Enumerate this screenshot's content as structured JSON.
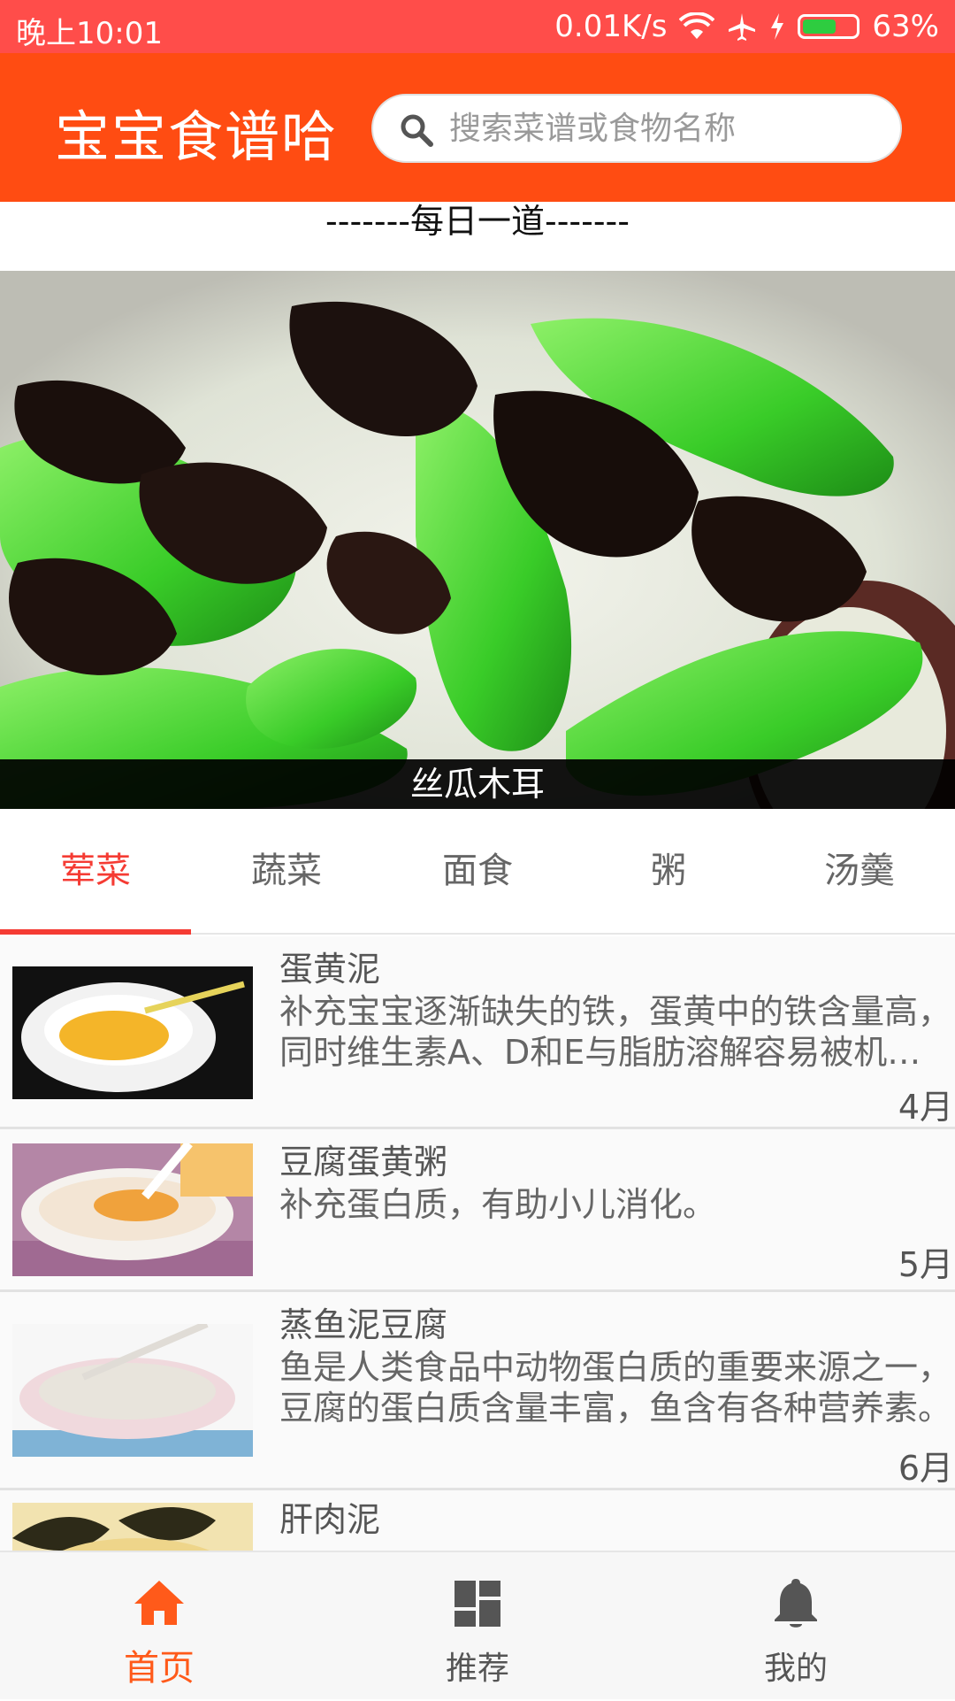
{
  "status_bar": {
    "time": "晚上10:01",
    "network_speed": "0.01K/s",
    "battery_percent": "63%",
    "battery_level": 0.63
  },
  "header": {
    "app_title": "宝宝食谱哈",
    "search_placeholder": "搜索菜谱或食物名称"
  },
  "daily": {
    "heading": "-------每日一道-------",
    "dish_name": "丝瓜木耳"
  },
  "tabs": [
    {
      "label": "荤菜",
      "active": true
    },
    {
      "label": "蔬菜",
      "active": false
    },
    {
      "label": "面食",
      "active": false
    },
    {
      "label": "粥",
      "active": false
    },
    {
      "label": "汤羹",
      "active": false
    }
  ],
  "recipes": [
    {
      "title": "蛋黄泥",
      "description": "补充宝宝逐渐缺失的铁，蛋黄中的铁含量高，同时维生素A、D和E与脂肪溶解容易被机体吸收利用。",
      "month": "4月"
    },
    {
      "title": "豆腐蛋黄粥",
      "description": "补充蛋白质，有助小儿消化。",
      "month": "5月"
    },
    {
      "title": "蒸鱼泥豆腐",
      "description": "鱼是人类食品中动物蛋白质的重要来源之一，豆腐的蛋白质含量丰富，鱼含有各种营养素。",
      "month": "6月"
    },
    {
      "title": "肝肉泥",
      "description": "",
      "month": ""
    }
  ],
  "bottom_nav": [
    {
      "label": "首页",
      "icon": "home-icon",
      "active": true
    },
    {
      "label": "推荐",
      "icon": "dashboard-icon",
      "active": false
    },
    {
      "label": "我的",
      "icon": "bell-icon",
      "active": false
    }
  ],
  "colors": {
    "status_bar": "#ff4d4a",
    "header": "#ff4c12",
    "accent": "#f53b33",
    "nav_active": "#ff5a1a"
  }
}
